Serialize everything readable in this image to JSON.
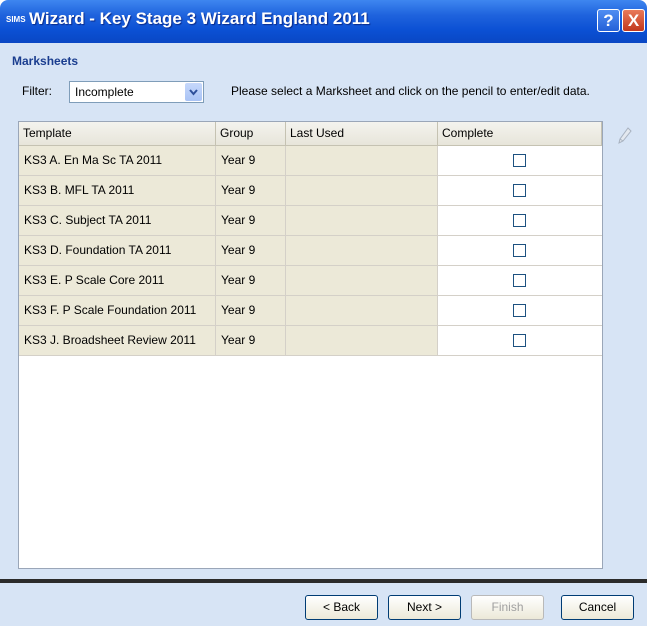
{
  "window": {
    "logo": "SIMS",
    "title": "Wizard - Key Stage 3 Wizard England 2011",
    "help_label": "?",
    "close_label": "X"
  },
  "section": {
    "title": "Marksheets"
  },
  "filter": {
    "label": "Filter:",
    "value": "Incomplete"
  },
  "instruction": "Please select a Marksheet and click on the pencil to enter/edit data.",
  "table": {
    "columns": [
      "Template",
      "Group",
      "Last Used",
      "Complete"
    ],
    "rows": [
      {
        "template": "KS3 A. En Ma Sc TA 2011",
        "group": "Year  9",
        "last_used": "",
        "complete": false
      },
      {
        "template": "KS3 B. MFL TA 2011",
        "group": "Year  9",
        "last_used": "",
        "complete": false
      },
      {
        "template": "KS3 C. Subject TA 2011",
        "group": "Year  9",
        "last_used": "",
        "complete": false
      },
      {
        "template": "KS3 D. Foundation TA 2011",
        "group": "Year  9",
        "last_used": "",
        "complete": false
      },
      {
        "template": "KS3 E. P Scale Core 2011",
        "group": "Year  9",
        "last_used": "",
        "complete": false
      },
      {
        "template": "KS3 F. P Scale Foundation 2011",
        "group": "Year  9",
        "last_used": "",
        "complete": false
      },
      {
        "template": "KS3 J. Broadsheet Review 2011",
        "group": "Year  9",
        "last_used": "",
        "complete": false
      }
    ]
  },
  "icons": {
    "edit": "pencil-icon"
  },
  "buttons": {
    "back": "< Back",
    "next": "Next >",
    "finish": "Finish",
    "cancel": "Cancel"
  }
}
